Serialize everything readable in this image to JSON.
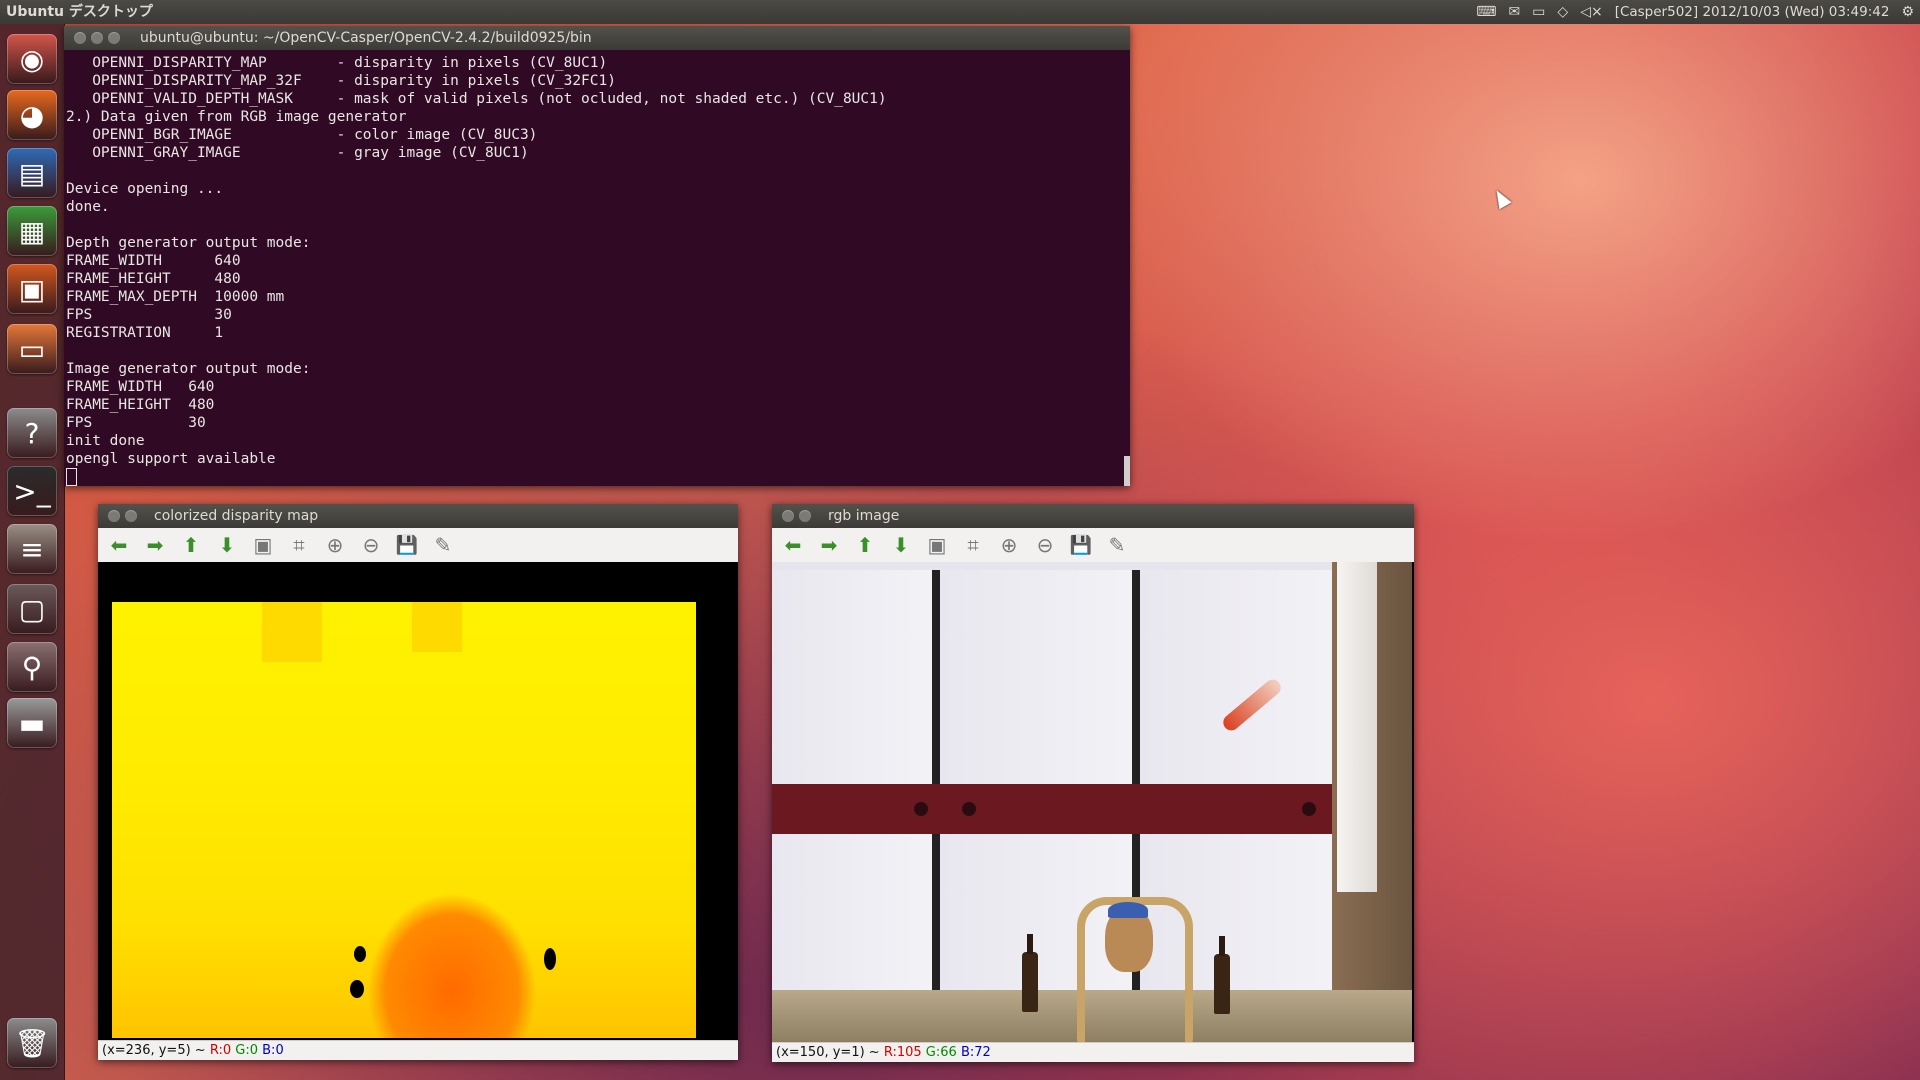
{
  "top_panel": {
    "title": "Ubuntu デスクトップ",
    "clock": "[Casper502] 2012/10/03 (Wed) 03:49:42",
    "tray_icons": [
      "keyboard-icon",
      "mail-icon",
      "battery-icon",
      "wifi-icon",
      "volume-muted-icon",
      "gear-icon"
    ]
  },
  "launcher": {
    "items": [
      {
        "name": "dash-home",
        "glyph": "◉",
        "color": "#d3564a"
      },
      {
        "name": "firefox",
        "glyph": "◕",
        "color": "#e86a1e"
      },
      {
        "name": "libreoffice-writer",
        "glyph": "▤",
        "color": "#2f6bb6"
      },
      {
        "name": "libreoffice-calc",
        "glyph": "▦",
        "color": "#3a9c3a"
      },
      {
        "name": "libreoffice-impress",
        "glyph": "▣",
        "color": "#d2581e"
      },
      {
        "name": "files",
        "glyph": "▭",
        "color": "#e6783a"
      },
      {
        "name": "help",
        "glyph": "?",
        "color": "#8c8c8c"
      },
      {
        "name": "terminal",
        "glyph": ">_",
        "color": "#2b2b2b"
      },
      {
        "name": "software-center",
        "glyph": "≡",
        "color": "#9a8f86"
      },
      {
        "name": "workspace-switcher",
        "glyph": "▢",
        "color": "#6b5a5a"
      },
      {
        "name": "usb-drive",
        "glyph": "⚲",
        "color": "#8a7070"
      },
      {
        "name": "drive",
        "glyph": "▬",
        "color": "#9a9a9a"
      },
      {
        "name": "trash",
        "glyph": "🗑",
        "color": "#8c8c8c"
      }
    ]
  },
  "terminal": {
    "title": "ubuntu@ubuntu: ~/OpenCV-Casper/OpenCV-2.4.2/build0925/bin",
    "lines": [
      "   OPENNI_DISPARITY_MAP        - disparity in pixels (CV_8UC1)",
      "   OPENNI_DISPARITY_MAP_32F    - disparity in pixels (CV_32FC1)",
      "   OPENNI_VALID_DEPTH_MASK     - mask of valid pixels (not ocluded, not shaded etc.) (CV_8UC1)",
      "2.) Data given from RGB image generator",
      "   OPENNI_BGR_IMAGE            - color image (CV_8UC3)",
      "   OPENNI_GRAY_IMAGE           - gray image (CV_8UC1)",
      "",
      "Device opening ...",
      "done.",
      "",
      "Depth generator output mode:",
      "FRAME_WIDTH      640",
      "FRAME_HEIGHT     480",
      "FRAME_MAX_DEPTH  10000 mm",
      "FPS              30",
      "REGISTRATION     1",
      "",
      "Image generator output mode:",
      "FRAME_WIDTH   640",
      "FRAME_HEIGHT  480",
      "FPS           30",
      "init done",
      "opengl support available"
    ]
  },
  "disparity_window": {
    "title": "colorized disparity map",
    "status_prefix": "(x=236, y=5) ~ ",
    "r": "R:0",
    "g": "G:0",
    "b": "B:0"
  },
  "rgb_window": {
    "title": "rgb image",
    "status_prefix": "(x=150, y=1) ~ ",
    "r": "R:105",
    "g": "G:66",
    "b": "B:72"
  },
  "toolbar_buttons": [
    "arrow-left-icon",
    "arrow-right-icon",
    "arrow-up-icon",
    "arrow-down-icon",
    "image-icon",
    "zoom-fit-icon",
    "zoom-in-icon",
    "zoom-out-icon",
    "save-icon",
    "properties-icon"
  ],
  "toolbar_glyphs": [
    "⬅",
    "➡",
    "⬆",
    "⬇",
    "▣",
    "⌗",
    "⊕",
    "⊖",
    "💾",
    "✎"
  ]
}
